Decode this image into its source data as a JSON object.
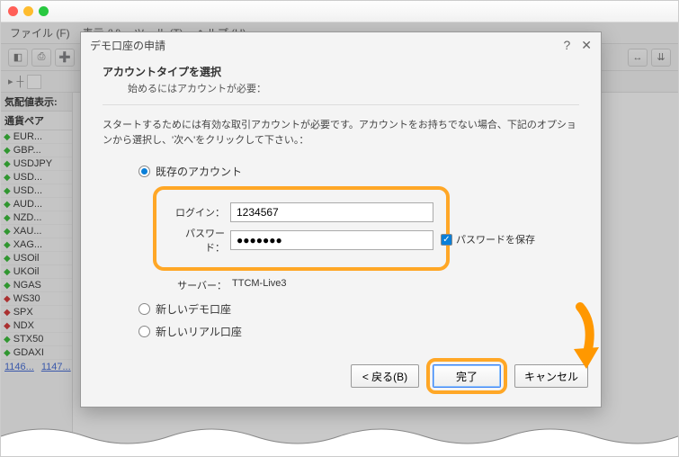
{
  "menubar": {
    "file": "ファイル (F)",
    "view": "表示 (V)",
    "tools": "ツール (T)",
    "help": "ヘルプ (H)"
  },
  "sidebar": {
    "title": "気配値表示:",
    "header": "通貨ペア",
    "rows": [
      {
        "dir": "up",
        "sym": "EUR..."
      },
      {
        "dir": "up",
        "sym": "GBP..."
      },
      {
        "dir": "up",
        "sym": "USDJPY"
      },
      {
        "dir": "up",
        "sym": "USD..."
      },
      {
        "dir": "up",
        "sym": "USD..."
      },
      {
        "dir": "up",
        "sym": "AUD..."
      },
      {
        "dir": "up",
        "sym": "NZD..."
      },
      {
        "dir": "up",
        "sym": "XAU..."
      },
      {
        "dir": "up",
        "sym": "XAG..."
      },
      {
        "dir": "up",
        "sym": "USOil"
      },
      {
        "dir": "up",
        "sym": "UKOil"
      },
      {
        "dir": "up",
        "sym": "NGAS"
      },
      {
        "dir": "dn",
        "sym": "WS30"
      },
      {
        "dir": "dn",
        "sym": "SPX"
      },
      {
        "dir": "dn",
        "sym": "NDX"
      },
      {
        "dir": "up",
        "sym": "STX50"
      },
      {
        "dir": "up",
        "sym": "GDAXI"
      }
    ],
    "nums": {
      "a": "1146...",
      "b": "1147..."
    }
  },
  "dialog": {
    "title": "デモ口座の申請",
    "section_h": "アカウントタイプを選択",
    "section_sub": "始めるにはアカウントが必要：",
    "desc": "スタートするためには有効な取引アカウントが必要です。アカウントをお持ちでない場合、下記のオプションから選択し、'次へ'をクリックして下さい。：",
    "radio_existing": "既存のアカウント",
    "login_label": "ログイン：",
    "login_value": "1234567",
    "password_label": "パスワード：",
    "password_value": "●●●●●●●",
    "save_pw": "パスワードを保存",
    "server_label": "サーバー：",
    "server_value": "TTCM-Live3",
    "radio_demo": "新しいデモ口座",
    "radio_real": "新しいリアル口座",
    "btn_back": "< 戻る(B)",
    "btn_done": "完了",
    "btn_cancel": "キャンセル"
  }
}
